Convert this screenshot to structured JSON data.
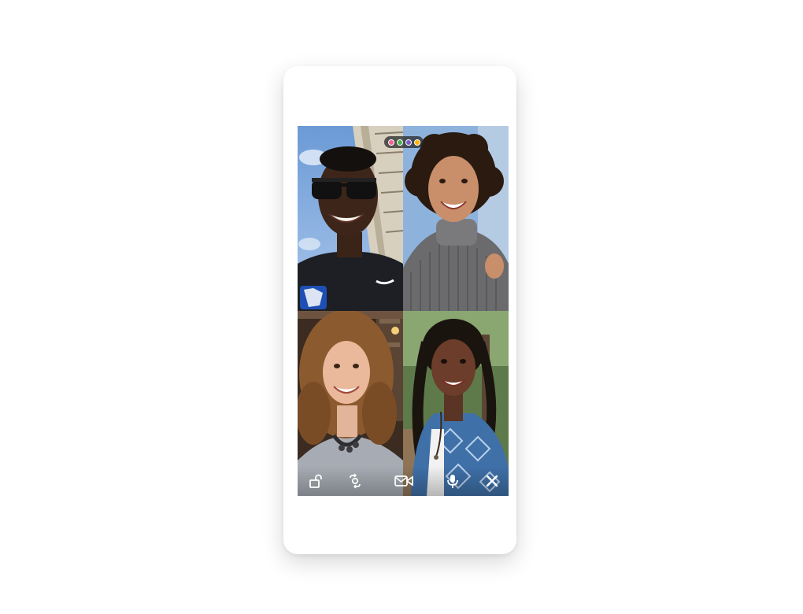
{
  "call": {
    "participant_count": 4,
    "indicator_dots": [
      {
        "color": "#f06292"
      },
      {
        "color": "#4caf50"
      },
      {
        "color": "#7e57c2"
      },
      {
        "color": "#ffb300"
      }
    ]
  },
  "controls": [
    {
      "icon": "lock-icon"
    },
    {
      "icon": "flip-camera-icon"
    },
    {
      "icon": "video-camera-icon"
    },
    {
      "icon": "microphone-icon"
    },
    {
      "icon": "close-icon"
    }
  ]
}
